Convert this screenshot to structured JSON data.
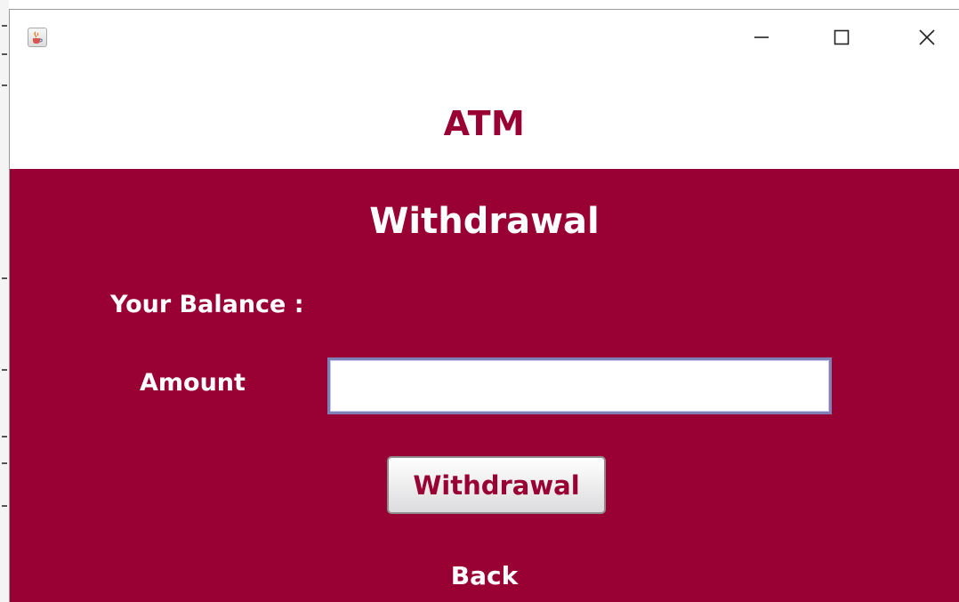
{
  "window": {
    "app_icon": "java-cup-icon",
    "controls": {
      "minimize_icon": "minimize-icon",
      "maximize_icon": "maximize-icon",
      "close_icon": "close-icon"
    }
  },
  "header": {
    "title": "ATM"
  },
  "panel": {
    "title": "Withdrawal",
    "balance_label": "Your Balance :",
    "amount_label": "Amount",
    "amount_value": "",
    "withdraw_button_label": "Withdrawal",
    "back_label": "Back"
  },
  "colors": {
    "brand": "#990033",
    "panel_text": "#ffffff",
    "input_border": "#7f7fb8"
  }
}
